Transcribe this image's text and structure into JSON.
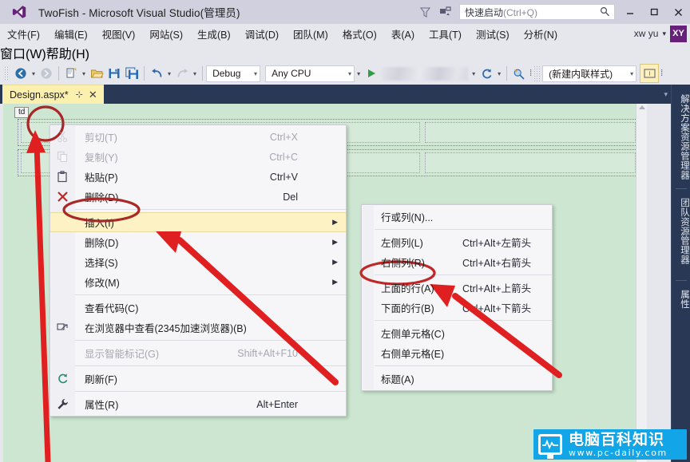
{
  "window": {
    "title": "TwoFish - Microsoft Visual Studio(管理员)",
    "logo_icon": "visual-studio-logo",
    "feedback_icon": "feedback-funnel-icon",
    "notify_icon": "notifications-icon",
    "minimize_label": "—",
    "maximize_label": "□",
    "close_label": "✕"
  },
  "quick_launch": {
    "label": "快速启动",
    "hint": "(Ctrl+Q)",
    "search_icon": "search-icon"
  },
  "account": {
    "name": "xw yu",
    "caret": "▾",
    "initials": "XY"
  },
  "menubar": {
    "row1": [
      "文件(F)",
      "编辑(E)",
      "视图(V)",
      "网站(S)",
      "生成(B)",
      "调试(D)",
      "团队(M)",
      "格式(O)",
      "表(A)",
      "工具(T)",
      "测试(S)",
      "分析(N)"
    ],
    "row2": [
      "窗口(W)",
      "帮助(H)"
    ]
  },
  "toolbar": {
    "nav_back_icon": "navigate-back-icon",
    "nav_forward_icon": "navigate-forward-icon",
    "new_item_icon": "new-item-icon",
    "open_file_icon": "open-file-icon",
    "save_icon": "save-icon",
    "save_all_icon": "save-all-icon",
    "undo_icon": "undo-icon",
    "redo_icon": "redo-icon",
    "config_value": "Debug",
    "platform_value": "Any CPU",
    "start_icon": "start-debug-icon",
    "browser_value": "",
    "refresh_icon": "refresh-icon",
    "find_icon": "find-icon",
    "style_value": "(新建内联样式)",
    "style_target_icon": "style-target-icon",
    "overflow_label": "⋮"
  },
  "tab": {
    "name": "Design.aspx*",
    "pin_icon": "pin-icon",
    "close_icon": "close-icon",
    "overflow_caret": "▾"
  },
  "designer": {
    "tag_label": "td",
    "scroll_up_icon": "scroll-up-arrow-icon"
  },
  "right_dock": {
    "tabs": [
      "解决方案资源管理器",
      "团队资源管理器",
      "属性"
    ]
  },
  "context_menu": {
    "items": [
      {
        "label": "剪切(T)",
        "accel": "Ctrl+X",
        "icon": "cut-icon",
        "disabled": true,
        "submenu": false,
        "highlighted": false,
        "sep_after": false
      },
      {
        "label": "复制(Y)",
        "accel": "Ctrl+C",
        "icon": "copy-icon",
        "disabled": true,
        "submenu": false,
        "highlighted": false,
        "sep_after": false
      },
      {
        "label": "粘贴(P)",
        "accel": "Ctrl+V",
        "icon": "paste-icon",
        "disabled": false,
        "submenu": false,
        "highlighted": false,
        "sep_after": false
      },
      {
        "label": "删除(D)",
        "accel": "Del",
        "icon": "delete-x-icon",
        "disabled": false,
        "submenu": false,
        "highlighted": false,
        "sep_after": true
      },
      {
        "label": "插入(I)",
        "accel": "",
        "icon": "",
        "disabled": false,
        "submenu": true,
        "highlighted": true,
        "sep_after": false
      },
      {
        "label": "删除(D)",
        "accel": "",
        "icon": "",
        "disabled": false,
        "submenu": true,
        "highlighted": false,
        "sep_after": false
      },
      {
        "label": "选择(S)",
        "accel": "",
        "icon": "",
        "disabled": false,
        "submenu": true,
        "highlighted": false,
        "sep_after": false
      },
      {
        "label": "修改(M)",
        "accel": "",
        "icon": "",
        "disabled": false,
        "submenu": true,
        "highlighted": false,
        "sep_after": true
      },
      {
        "label": "查看代码(C)",
        "accel": "",
        "icon": "",
        "disabled": false,
        "submenu": false,
        "highlighted": false,
        "sep_after": false
      },
      {
        "label": "在浏览器中查看(2345加速浏览器)(B)",
        "accel": "",
        "icon": "view-in-browser-icon",
        "disabled": false,
        "submenu": false,
        "highlighted": false,
        "sep_after": true
      },
      {
        "label": "显示智能标记(G)",
        "accel": "Shift+Alt+F10",
        "icon": "",
        "disabled": true,
        "submenu": false,
        "highlighted": false,
        "sep_after": true
      },
      {
        "label": "刷新(F)",
        "accel": "",
        "icon": "refresh-icon",
        "disabled": false,
        "submenu": false,
        "highlighted": false,
        "sep_after": true
      },
      {
        "label": "属性(R)",
        "accel": "Alt+Enter",
        "icon": "properties-wrench-icon",
        "disabled": false,
        "submenu": false,
        "highlighted": false,
        "sep_after": false
      }
    ]
  },
  "submenu": {
    "items": [
      {
        "label": "行或列(N)...",
        "accel": "",
        "sep_after": true
      },
      {
        "label": "左侧列(L)",
        "accel": "Ctrl+Alt+左箭头",
        "sep_after": false
      },
      {
        "label": "右侧列(R)",
        "accel": "Ctrl+Alt+右箭头",
        "sep_after": true
      },
      {
        "label": "上面的行(A)",
        "accel": "Ctrl+Alt+上箭头",
        "sep_after": false
      },
      {
        "label": "下面的行(B)",
        "accel": "Ctrl+Alt+下箭头",
        "sep_after": true
      },
      {
        "label": "左侧单元格(C)",
        "accel": "",
        "sep_after": false
      },
      {
        "label": "右侧单元格(E)",
        "accel": "",
        "sep_after": true
      },
      {
        "label": "标题(A)",
        "accel": "",
        "sep_after": false
      }
    ]
  },
  "annotations": {
    "accent_color": "#e02020",
    "circle_color": "#a82828",
    "ellipse_td_cell": "highlight-on-table-cell",
    "ellipse_insert": "highlight-on-insert-menu-item",
    "ellipse_row_above": "highlight-on-row-above-item",
    "arrow_to_cell": "arrow-pointing-to-cell",
    "arrow_to_insert": "arrow-pointing-to-insert",
    "arrow_to_row_above": "arrow-pointing-to-row-above"
  },
  "watermark": {
    "brand_cn": "电脑百科知识",
    "url": "www.pc-daily.com",
    "monitor_icon": "monitor-pulse-icon",
    "bg_color": "#12a6e8"
  }
}
